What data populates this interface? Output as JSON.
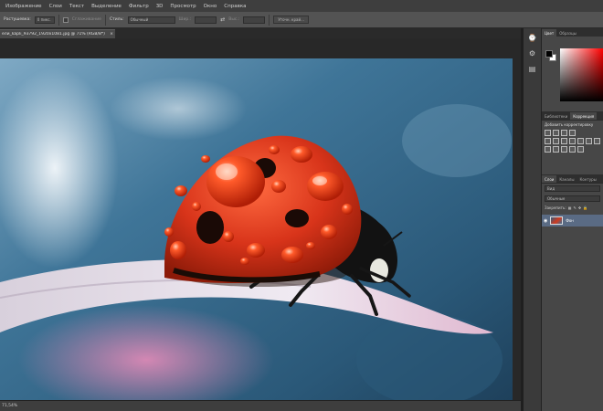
{
  "menubar": {
    "items": [
      "Изображение",
      "Слои",
      "Текст",
      "Выделение",
      "Фильтр",
      "3D",
      "Просмотр",
      "Окно",
      "Справка"
    ]
  },
  "optionsbar": {
    "feather_label": "Растушевка:",
    "feather_value": "0 пикс.",
    "antialias_label": "Сглаживание",
    "style_label": "Стиль:",
    "style_value": "Обычный",
    "width_label": "Шир.:",
    "height_label": "Выс.:",
    "refine_button": "Уточн. край..."
  },
  "document": {
    "tab_title": "ели_kapli_93792_1920x1081.jpg @ 71% (RGB/8*)",
    "zoom_status": "71,54%"
  },
  "panels": {
    "color_tabs": [
      "Цвет",
      "Образцы"
    ],
    "adj_tabs": [
      "Библиотеки",
      "Коррекция"
    ],
    "adj_title": "Добавить корректировку",
    "layer_tabs": [
      "Слои",
      "Каналы",
      "Контуры"
    ],
    "layer_filter": "Вид",
    "blend_mode": "Обычные",
    "lock_label": "Закрепить:",
    "layer_name": "Фон"
  },
  "colors": {
    "accent_selected_layer": "#5a6b84",
    "ladybug": "#d8341a",
    "background_blue": "#3f7598"
  }
}
